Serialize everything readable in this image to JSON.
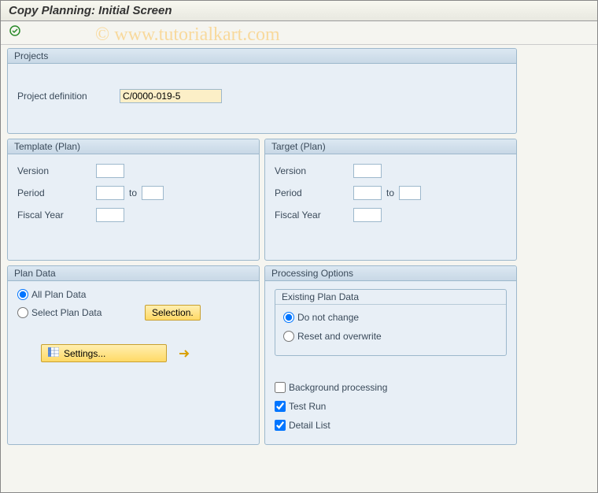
{
  "title": "Copy Planning: Initial Screen",
  "watermark": "© www.tutorialkart.com",
  "projects": {
    "header": "Projects",
    "definition_label": "Project definition",
    "definition_value": "C/0000-019-5"
  },
  "template": {
    "header": "Template (Plan)",
    "version_label": "Version",
    "version_value": "",
    "period_label": "Period",
    "period_from": "",
    "to_label": "to",
    "period_to": "",
    "fiscal_label": "Fiscal Year",
    "fiscal_value": ""
  },
  "target": {
    "header": "Target (Plan)",
    "version_label": "Version",
    "version_value": "",
    "period_label": "Period",
    "period_from": "",
    "to_label": "to",
    "period_to": "",
    "fiscal_label": "Fiscal Year",
    "fiscal_value": ""
  },
  "plan_data": {
    "header": "Plan Data",
    "all_label": "All Plan Data",
    "select_label": "Select Plan Data",
    "selection_btn": "Selection.",
    "settings_btn": "Settings..."
  },
  "processing": {
    "header": "Processing Options",
    "existing_header": "Existing Plan Data",
    "no_change_label": "Do not change",
    "reset_label": "Reset and overwrite",
    "background_label": "Background processing",
    "test_run_label": "Test Run",
    "detail_list_label": "Detail List"
  }
}
